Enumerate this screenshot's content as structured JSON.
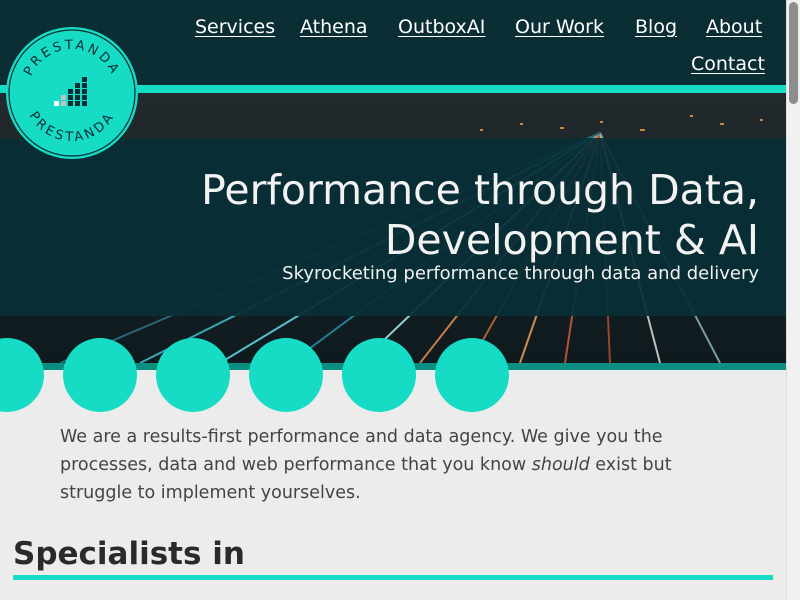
{
  "brand": {
    "logo_text": "PRESTANDA"
  },
  "nav": {
    "links": [
      "Services",
      "Athena",
      "OutboxAI",
      "Our Work",
      "Blog",
      "About",
      "Contact"
    ]
  },
  "hero": {
    "title_line1": "Performance through Data,",
    "title_line2": "Development & AI",
    "subtitle": "Skyrocketing performance through data and delivery"
  },
  "intro": {
    "text_before": "We are a results-first performance and data agency. We give you the processes, data and web performance that you know ",
    "emphasis": "should",
    "text_after": " exist but struggle to implement yourselves."
  },
  "section": {
    "title": "Specialists in"
  },
  "colors": {
    "accent": "#16dcc5",
    "header_bg": "#0b2d34",
    "hero_band": "#082e36",
    "text": "#444444"
  }
}
